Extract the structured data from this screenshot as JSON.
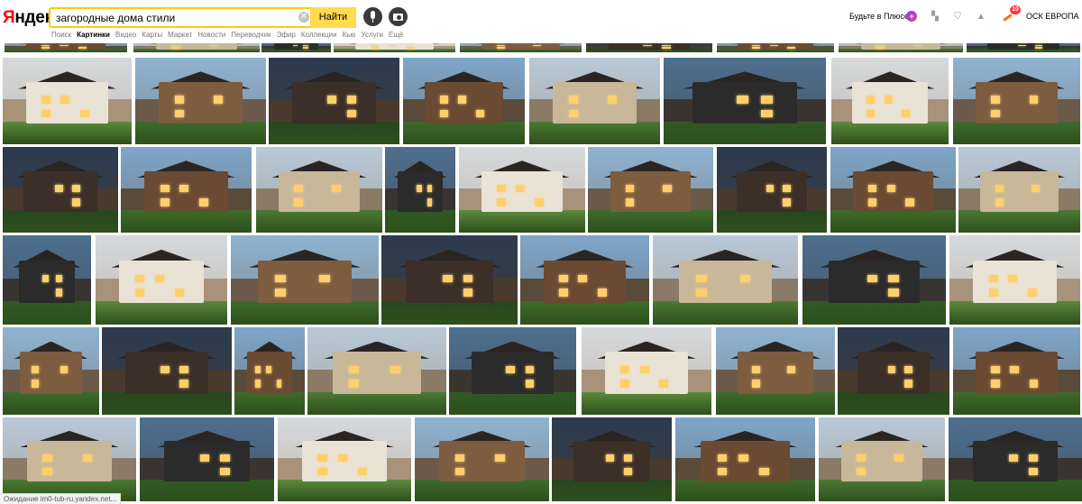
{
  "header": {
    "logo": "Яндекс",
    "search": {
      "value": "загородные дома стили",
      "clear": "✕"
    },
    "find_label": "Найти",
    "nav": [
      "Поиск",
      "Картинки",
      "Видео",
      "Карты",
      "Маркет",
      "Новости",
      "Переводчик",
      "Эфир",
      "Коллекции",
      "Кью",
      "Услуги",
      "Ещё"
    ],
    "active_nav": "Картинки",
    "plus_label": "Будьте в Плюсе",
    "plus_badge": "+",
    "notifications": "10",
    "user": "ОСК ЕВРОПА"
  },
  "icons": {
    "mic": "microphone-icon",
    "camera": "camera-icon",
    "collections": "collections-icon",
    "shield": "shield-icon",
    "bell": "bell-icon",
    "market": "market-icon"
  },
  "colors": {
    "accent": "#ffdb4d",
    "search_border": "#ffcc00",
    "logo_red": "#ff0000",
    "badge": "#ff3333"
  },
  "results_count": 44,
  "status": "Ожидание im0-tub-ru.yandex.net..."
}
